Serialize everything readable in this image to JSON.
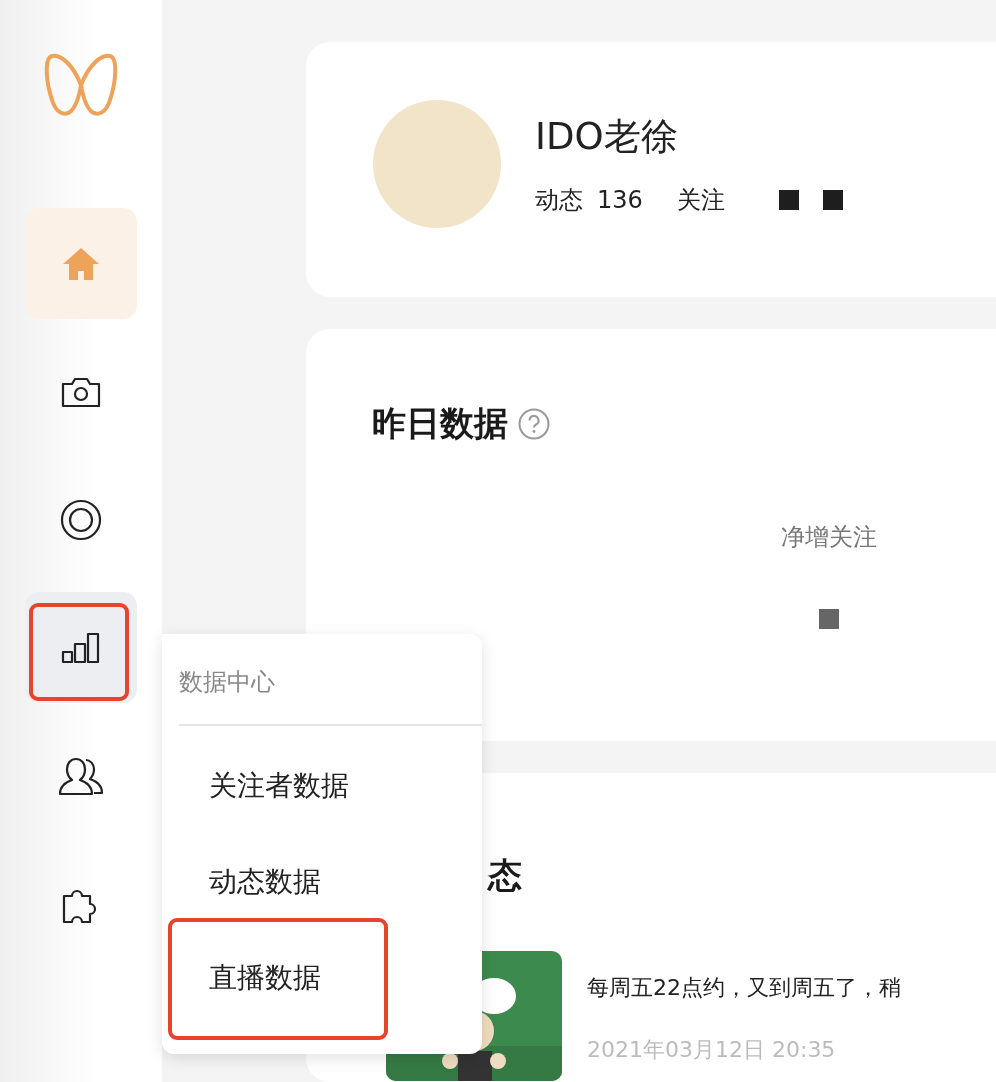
{
  "sidebar": {
    "items": [
      {
        "kind": "home",
        "selected": true,
        "hovered": false,
        "highlighted": false
      },
      {
        "kind": "camera",
        "selected": false,
        "hovered": false,
        "highlighted": false
      },
      {
        "kind": "live",
        "selected": false,
        "hovered": false,
        "highlighted": false
      },
      {
        "kind": "chart",
        "selected": false,
        "hovered": true,
        "highlighted": true
      },
      {
        "kind": "users",
        "selected": false,
        "hovered": false,
        "highlighted": false
      },
      {
        "kind": "plugin",
        "selected": false,
        "hovered": false,
        "highlighted": false
      }
    ]
  },
  "profile": {
    "name": "IDO老徐",
    "stats": [
      {
        "label": "动态",
        "value": "136"
      },
      {
        "label": "关注",
        "redacted": true
      }
    ]
  },
  "yesterday": {
    "title": "昨日数据",
    "metrics": [
      {
        "label": "净增关注",
        "redacted": true
      }
    ]
  },
  "posts": {
    "title": "态",
    "items": [
      {
        "text": "每周五22点约，又到周五了，稍",
        "time": "2021年03月12日 20:35"
      }
    ]
  },
  "menu": {
    "title": "数据中心",
    "items": [
      {
        "label": "关注者数据",
        "highlighted": false
      },
      {
        "label": "动态数据",
        "highlighted": false
      },
      {
        "label": "直播数据",
        "highlighted": true
      }
    ]
  }
}
